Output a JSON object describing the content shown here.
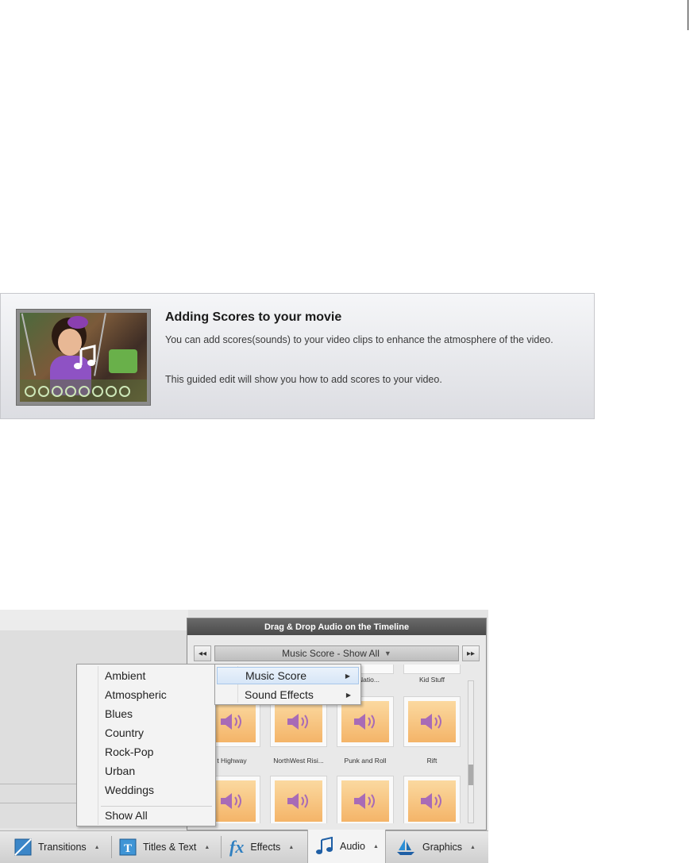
{
  "guided_edit": {
    "title": "Adding Scores to your movie",
    "description": "You can add scores(sounds) to your video clips to enhance the atmosphere of the video.",
    "note": "This guided edit will show you how to add scores to your video."
  },
  "audio_panel": {
    "header": "Drag & Drop Audio on the Timeline",
    "nav_prev": "◂◂",
    "nav_next": "▸▸",
    "category_selected": "Music Score - Show All",
    "tiles": [
      {
        "label": "al Natio..."
      },
      {
        "label": "Kid Stuff"
      },
      {
        "label": "t Highway"
      },
      {
        "label": "NorthWest Risi..."
      },
      {
        "label": "Punk and Roll"
      },
      {
        "label": "Rift"
      }
    ]
  },
  "main_menu": {
    "items": [
      {
        "label": "Music Score"
      },
      {
        "label": "Sound Effects"
      }
    ]
  },
  "sub_menu": {
    "items": [
      "Ambient",
      "Atmospheric",
      "Blues",
      "Country",
      "Rock-Pop",
      "Urban",
      "Weddings"
    ],
    "show_all": "Show All"
  },
  "tabs": [
    {
      "label": "Transitions",
      "icon": "transitions-icon"
    },
    {
      "label": "Titles & Text",
      "icon": "titles-icon"
    },
    {
      "label": "Effects",
      "icon": "fx-icon"
    },
    {
      "label": "Audio",
      "icon": "music-note-icon",
      "active": true
    },
    {
      "label": "Graphics",
      "icon": "sailboat-icon"
    }
  ],
  "colors": {
    "tile_fill": "#f4b468",
    "speaker": "#a86bb6",
    "header_bar": "#4a4a4a"
  }
}
